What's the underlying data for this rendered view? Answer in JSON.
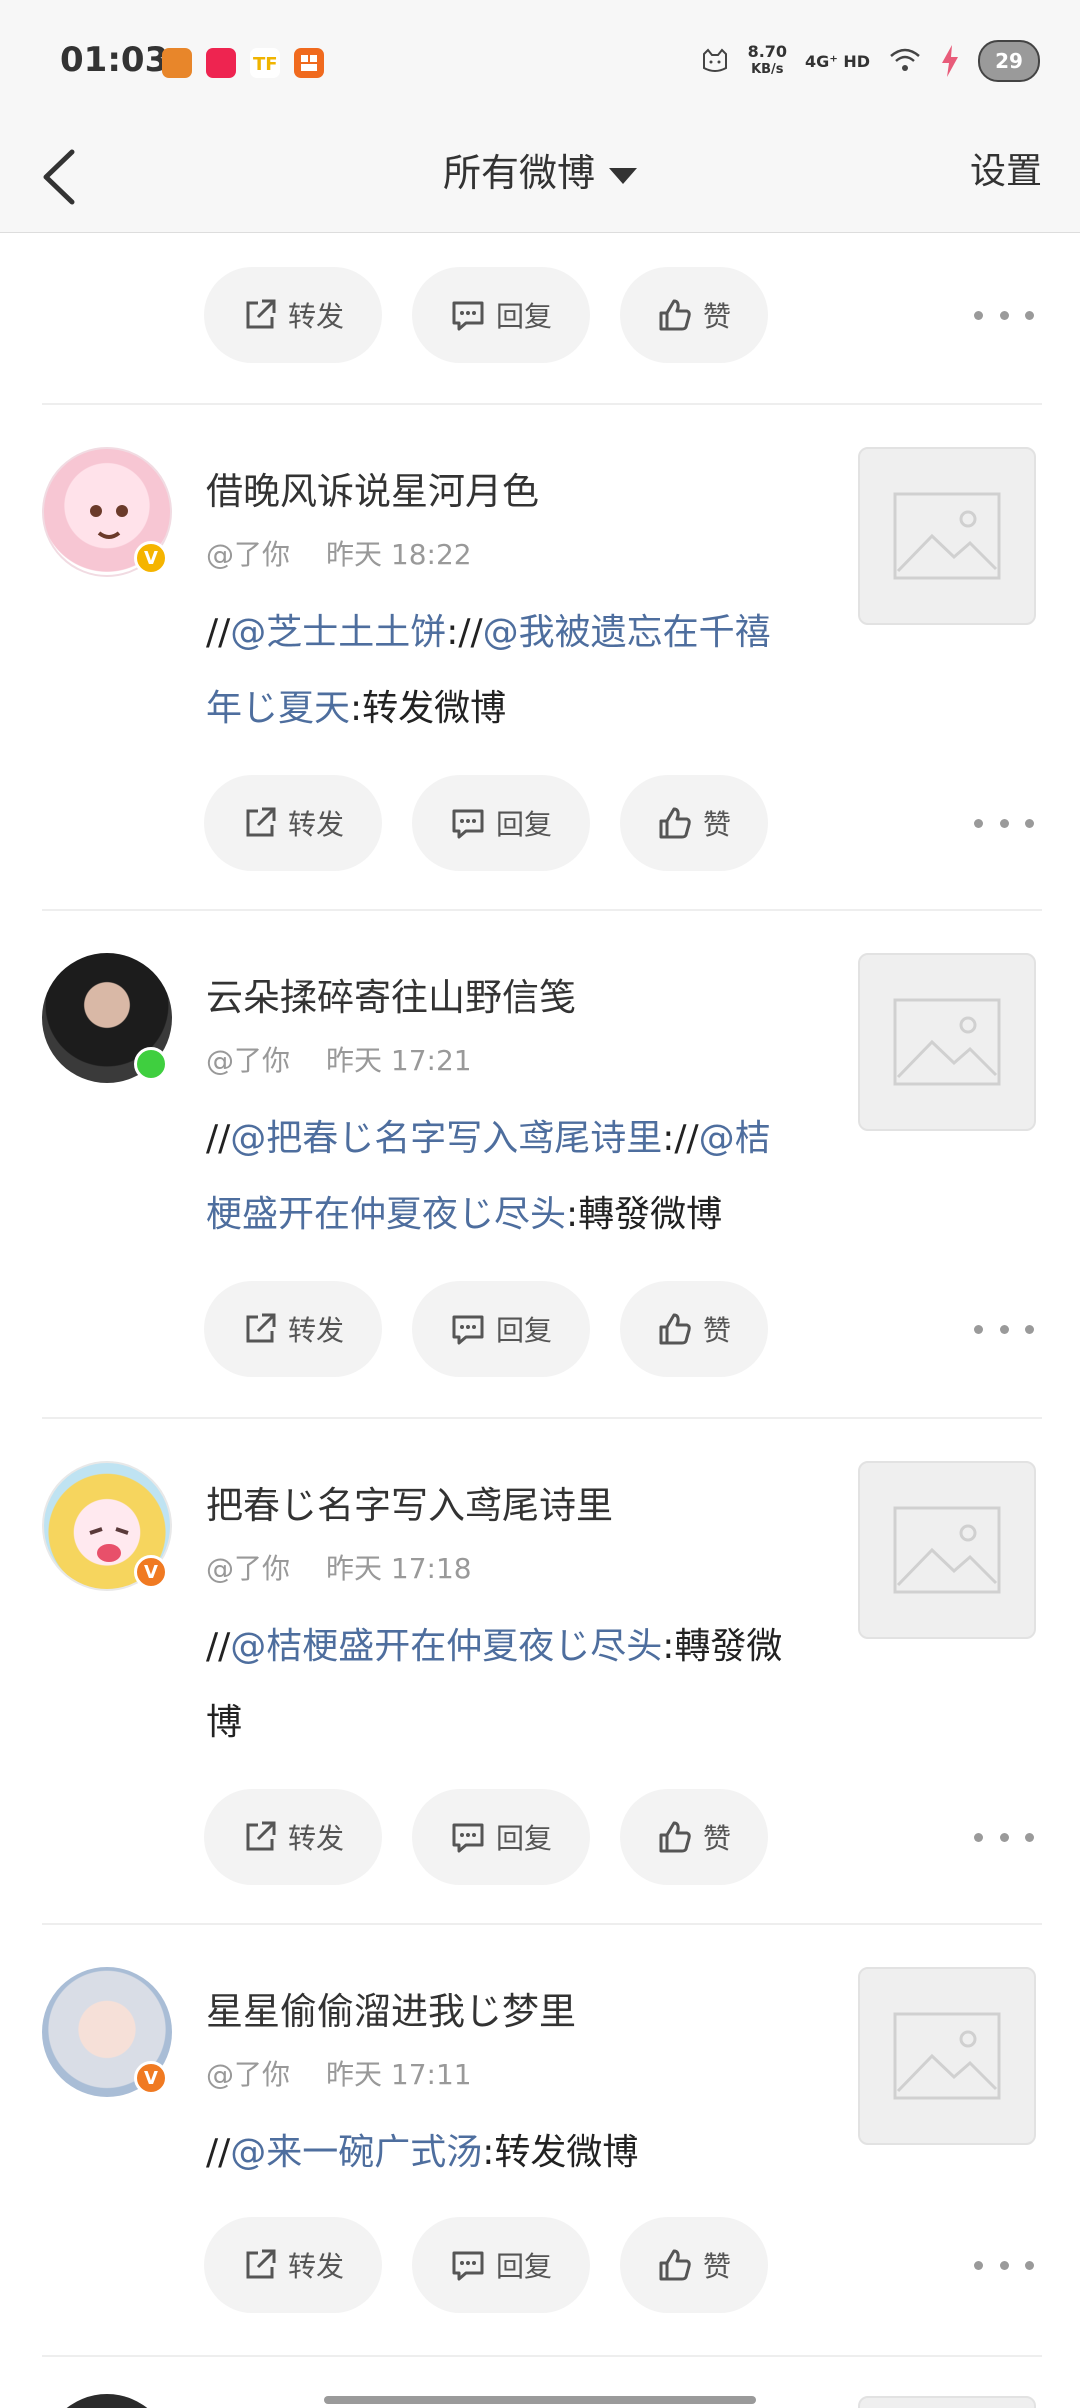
{
  "status_bar": {
    "time": "01:03",
    "app_icons": [
      "orange-animal-icon",
      "xiaohongshu-icon",
      "yellow-tf-icon",
      "orange-grid-icon"
    ],
    "net_speed_value": "8.70",
    "net_speed_unit": "KB/s",
    "network": "4G⁺ HD",
    "battery": "29"
  },
  "nav": {
    "title": "所有微博",
    "settings_label": "设置"
  },
  "actions": {
    "repost_label": "转发",
    "reply_label": "回复",
    "like_label": "赞"
  },
  "posts": [
    {
      "username": "借晚风诉说星河月色",
      "handle": "@了你",
      "time": "昨天 18:22",
      "body": [
        {
          "t": "//",
          "m": false
        },
        {
          "t": "@芝士土土饼",
          "m": true
        },
        {
          "t": "://",
          "m": false
        },
        {
          "t": "@我被遗忘在千禧年じ夏天",
          "m": true
        },
        {
          "t": ":转发微博",
          "m": false
        }
      ],
      "badge": "V",
      "badge_color": "#f5b400",
      "avatar_style": "pink-anime"
    },
    {
      "username": "云朵揉碎寄往山野信笺",
      "handle": "@了你",
      "time": "昨天 17:21",
      "body": [
        {
          "t": "//",
          "m": false
        },
        {
          "t": "@把春じ名字写入鸢尾诗里",
          "m": true
        },
        {
          "t": "://",
          "m": false
        },
        {
          "t": "@桔梗盛开在仲夏夜じ尽头",
          "m": true
        },
        {
          "t": ":轉發微博",
          "m": false
        }
      ],
      "badge": "",
      "badge_color": "#3fcf3f",
      "avatar_style": "dark-photo"
    },
    {
      "username": "把春じ名字写入鸢尾诗里",
      "handle": "@了你",
      "time": "昨天 17:18",
      "body": [
        {
          "t": "//",
          "m": false
        },
        {
          "t": "@桔梗盛开在仲夏夜じ尽头",
          "m": true
        },
        {
          "t": ":轉發微博",
          "m": false
        }
      ],
      "badge": "V",
      "badge_color": "#f07a22",
      "avatar_style": "yellow-anime"
    },
    {
      "username": "星星偷偷溜进我じ梦里",
      "handle": "@了你",
      "time": "昨天 17:11",
      "body": [
        {
          "t": "//",
          "m": false
        },
        {
          "t": "@来一碗广式汤",
          "m": true
        },
        {
          "t": ":转发微博",
          "m": false
        }
      ],
      "badge": "V",
      "badge_color": "#f07a22",
      "avatar_style": "light-photo"
    }
  ],
  "colors": {
    "mention": "#4e6e9e",
    "meta": "#999999",
    "button_bg": "#f3f3f3"
  }
}
